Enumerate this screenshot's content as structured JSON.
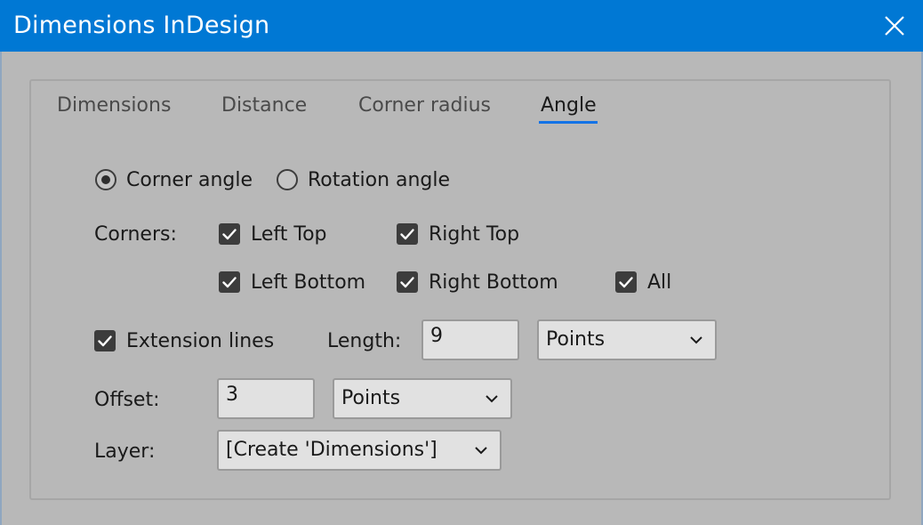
{
  "window": {
    "title": "Dimensions InDesign",
    "close_icon": "close-icon",
    "accent": "#0078d4"
  },
  "tabs": [
    {
      "label": "Dimensions",
      "active": false
    },
    {
      "label": "Distance",
      "active": false
    },
    {
      "label": "Corner radius",
      "active": false
    },
    {
      "label": "Angle",
      "active": true
    }
  ],
  "angle_type": {
    "options": [
      {
        "label": "Corner angle",
        "checked": true
      },
      {
        "label": "Rotation angle",
        "checked": false
      }
    ]
  },
  "corners": {
    "label": "Corners:",
    "items": [
      {
        "label": "Left Top",
        "checked": true
      },
      {
        "label": "Right Top",
        "checked": true
      },
      {
        "label": "Left Bottom",
        "checked": true
      },
      {
        "label": "Right Bottom",
        "checked": true
      },
      {
        "label": "All",
        "checked": true
      }
    ]
  },
  "extension_lines": {
    "label": "Extension lines",
    "checked": true,
    "length_label": "Length:",
    "length_value": "9",
    "length_unit": "Points"
  },
  "offset": {
    "label": "Offset:",
    "value": "3",
    "unit": "Points"
  },
  "layer": {
    "label": "Layer:",
    "value": "[Create 'Dimensions']"
  }
}
